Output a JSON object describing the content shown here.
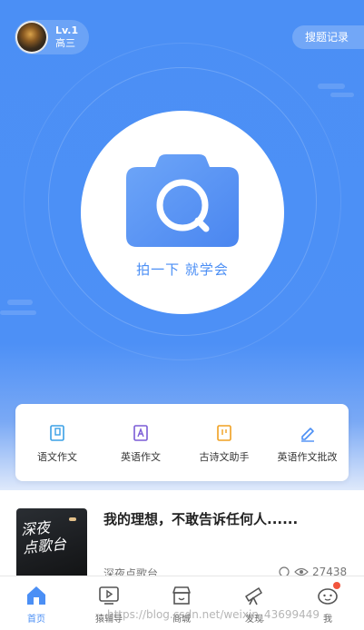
{
  "header": {
    "level": "Lv.1",
    "grade": "高三",
    "history_button": "搜题记录"
  },
  "camera": {
    "label": "拍一下 就学会"
  },
  "tools": [
    {
      "label": "语文作文",
      "icon": "book-icon",
      "color": "#3aa0e6"
    },
    {
      "label": "英语作文",
      "icon": "letter-a-icon",
      "color": "#7b5cd6"
    },
    {
      "label": "古诗文助手",
      "icon": "scroll-icon",
      "color": "#f0a020"
    },
    {
      "label": "英语作文批改",
      "icon": "pencil-icon",
      "color": "#4b8ff5"
    }
  ],
  "feed": {
    "thumbnail_text_1": "深夜",
    "thumbnail_text_2": "点歌台",
    "title": "我的理想，不敢告诉任何人......",
    "source": "深夜点歌台",
    "views": "27438"
  },
  "tabbar": {
    "items": [
      {
        "label": "首页",
        "icon": "home-icon",
        "active": true
      },
      {
        "label": "猿辅导",
        "icon": "play-screen-icon",
        "active": false
      },
      {
        "label": "商城",
        "icon": "shop-icon",
        "active": false
      },
      {
        "label": "发现",
        "icon": "telescope-icon",
        "active": false
      },
      {
        "label": "我",
        "icon": "face-icon",
        "active": false
      }
    ]
  },
  "watermark": "https://blog.csdn.net/weixin_43699449",
  "colors": {
    "accent": "#4b8ff5",
    "badge": "#f2553d"
  }
}
